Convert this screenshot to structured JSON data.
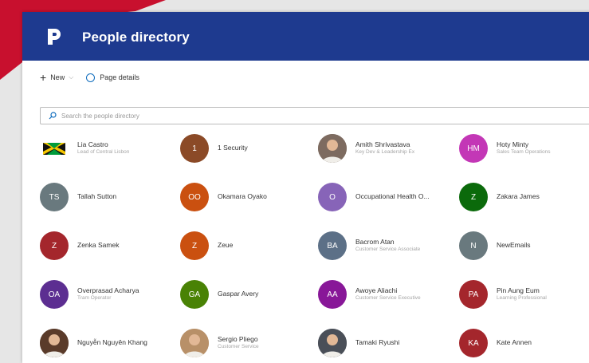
{
  "app": {
    "title": "People directory"
  },
  "toolbar": {
    "new_label": "New",
    "page_details_label": "Page details"
  },
  "search": {
    "placeholder": "Search the people directory"
  },
  "colors": {
    "header": "#1e3a8f",
    "accent_red": "#c8102e"
  },
  "people": [
    {
      "name": "Lia Castro",
      "role": "Lead of Central Lisbon",
      "initials": "",
      "color": "#ffffff",
      "photo": "flag"
    },
    {
      "name": "1 Security",
      "role": "",
      "initials": "1",
      "color": "#8b4a27"
    },
    {
      "name": "Amith Shrivastava",
      "role": "Key Dev & Leadership Ex",
      "initials": "",
      "color": "#7d6b60",
      "photo": "person"
    },
    {
      "name": "Hoty Minty",
      "role": "Sales Team Operations",
      "initials": "HM",
      "color": "#c337b6"
    },
    {
      "name": "Tallah Sutton",
      "role": "",
      "initials": "TS",
      "color": "#69797e"
    },
    {
      "name": "Okamara Oyako",
      "role": "",
      "initials": "OO",
      "color": "#ca5010"
    },
    {
      "name": "Occupational Health O...",
      "role": "",
      "initials": "O",
      "color": "#8764b8"
    },
    {
      "name": "Zakara James",
      "role": "",
      "initials": "Z",
      "color": "#0b6a0b"
    },
    {
      "name": "Zenka Samek",
      "role": "",
      "initials": "Z",
      "color": "#a4262c"
    },
    {
      "name": "Zeue",
      "role": "",
      "initials": "Z",
      "color": "#ca5010"
    },
    {
      "name": "Bacrom Atan",
      "role": "Customer Service Associate",
      "initials": "BA",
      "color": "#5c7087"
    },
    {
      "name": "NewEmails",
      "role": "",
      "initials": "N",
      "color": "#69797e"
    },
    {
      "name": "Overprasad Acharya",
      "role": "Tram Operator",
      "initials": "OA",
      "color": "#5c2e91"
    },
    {
      "name": "Gaspar Avery",
      "role": "",
      "initials": "GA",
      "color": "#498205"
    },
    {
      "name": "Awoye Aliachi",
      "role": "Customer Service Executive",
      "initials": "AA",
      "color": "#881798"
    },
    {
      "name": "Pin Aung Eum",
      "role": "Learning Professional",
      "initials": "PA",
      "color": "#a4262c"
    },
    {
      "name": "Nguyễn Nguyên Khang",
      "role": "",
      "initials": "",
      "color": "#5a3b2a",
      "photo": "person"
    },
    {
      "name": "Sergio Pliego",
      "role": "Customer Service",
      "initials": "",
      "color": "#b89068",
      "photo": "person"
    },
    {
      "name": "Tamaki Ryushi",
      "role": "",
      "initials": "",
      "color": "#4a4f58",
      "photo": "person"
    },
    {
      "name": "Kate Annen",
      "role": "",
      "initials": "KA",
      "color": "#a4262c"
    }
  ]
}
